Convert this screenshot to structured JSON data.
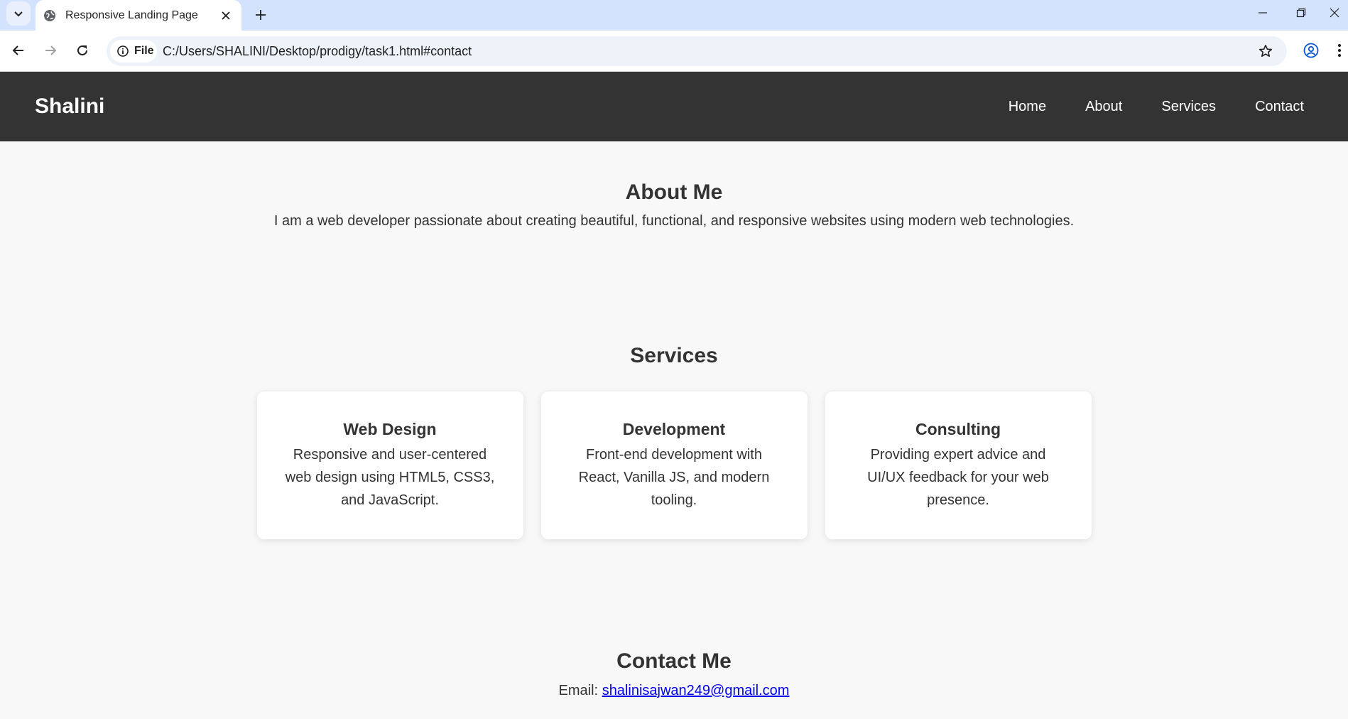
{
  "browser": {
    "tab_title": "Responsive Landing Page",
    "site_chip_label": "File",
    "url": "C:/Users/SHALINI/Desktop/prodigy/task1.html#contact"
  },
  "header": {
    "logo": "Shalini",
    "nav": [
      "Home",
      "About",
      "Services",
      "Contact"
    ]
  },
  "about": {
    "title": "About Me",
    "text": "I am a web developer passionate about creating beautiful, functional, and responsive websites using modern web technologies."
  },
  "services": {
    "title": "Services",
    "cards": [
      {
        "title": "Web Design",
        "text": "Responsive and user-centered web design using HTML5, CSS3, and JavaScript."
      },
      {
        "title": "Development",
        "text": "Front-end development with React, Vanilla JS, and modern tooling."
      },
      {
        "title": "Consulting",
        "text": "Providing expert advice and UI/UX feedback for your web presence."
      }
    ]
  },
  "contact": {
    "title": "Contact Me",
    "email_label": "Email:",
    "email": "shalinisajwan249@gmail.com"
  }
}
